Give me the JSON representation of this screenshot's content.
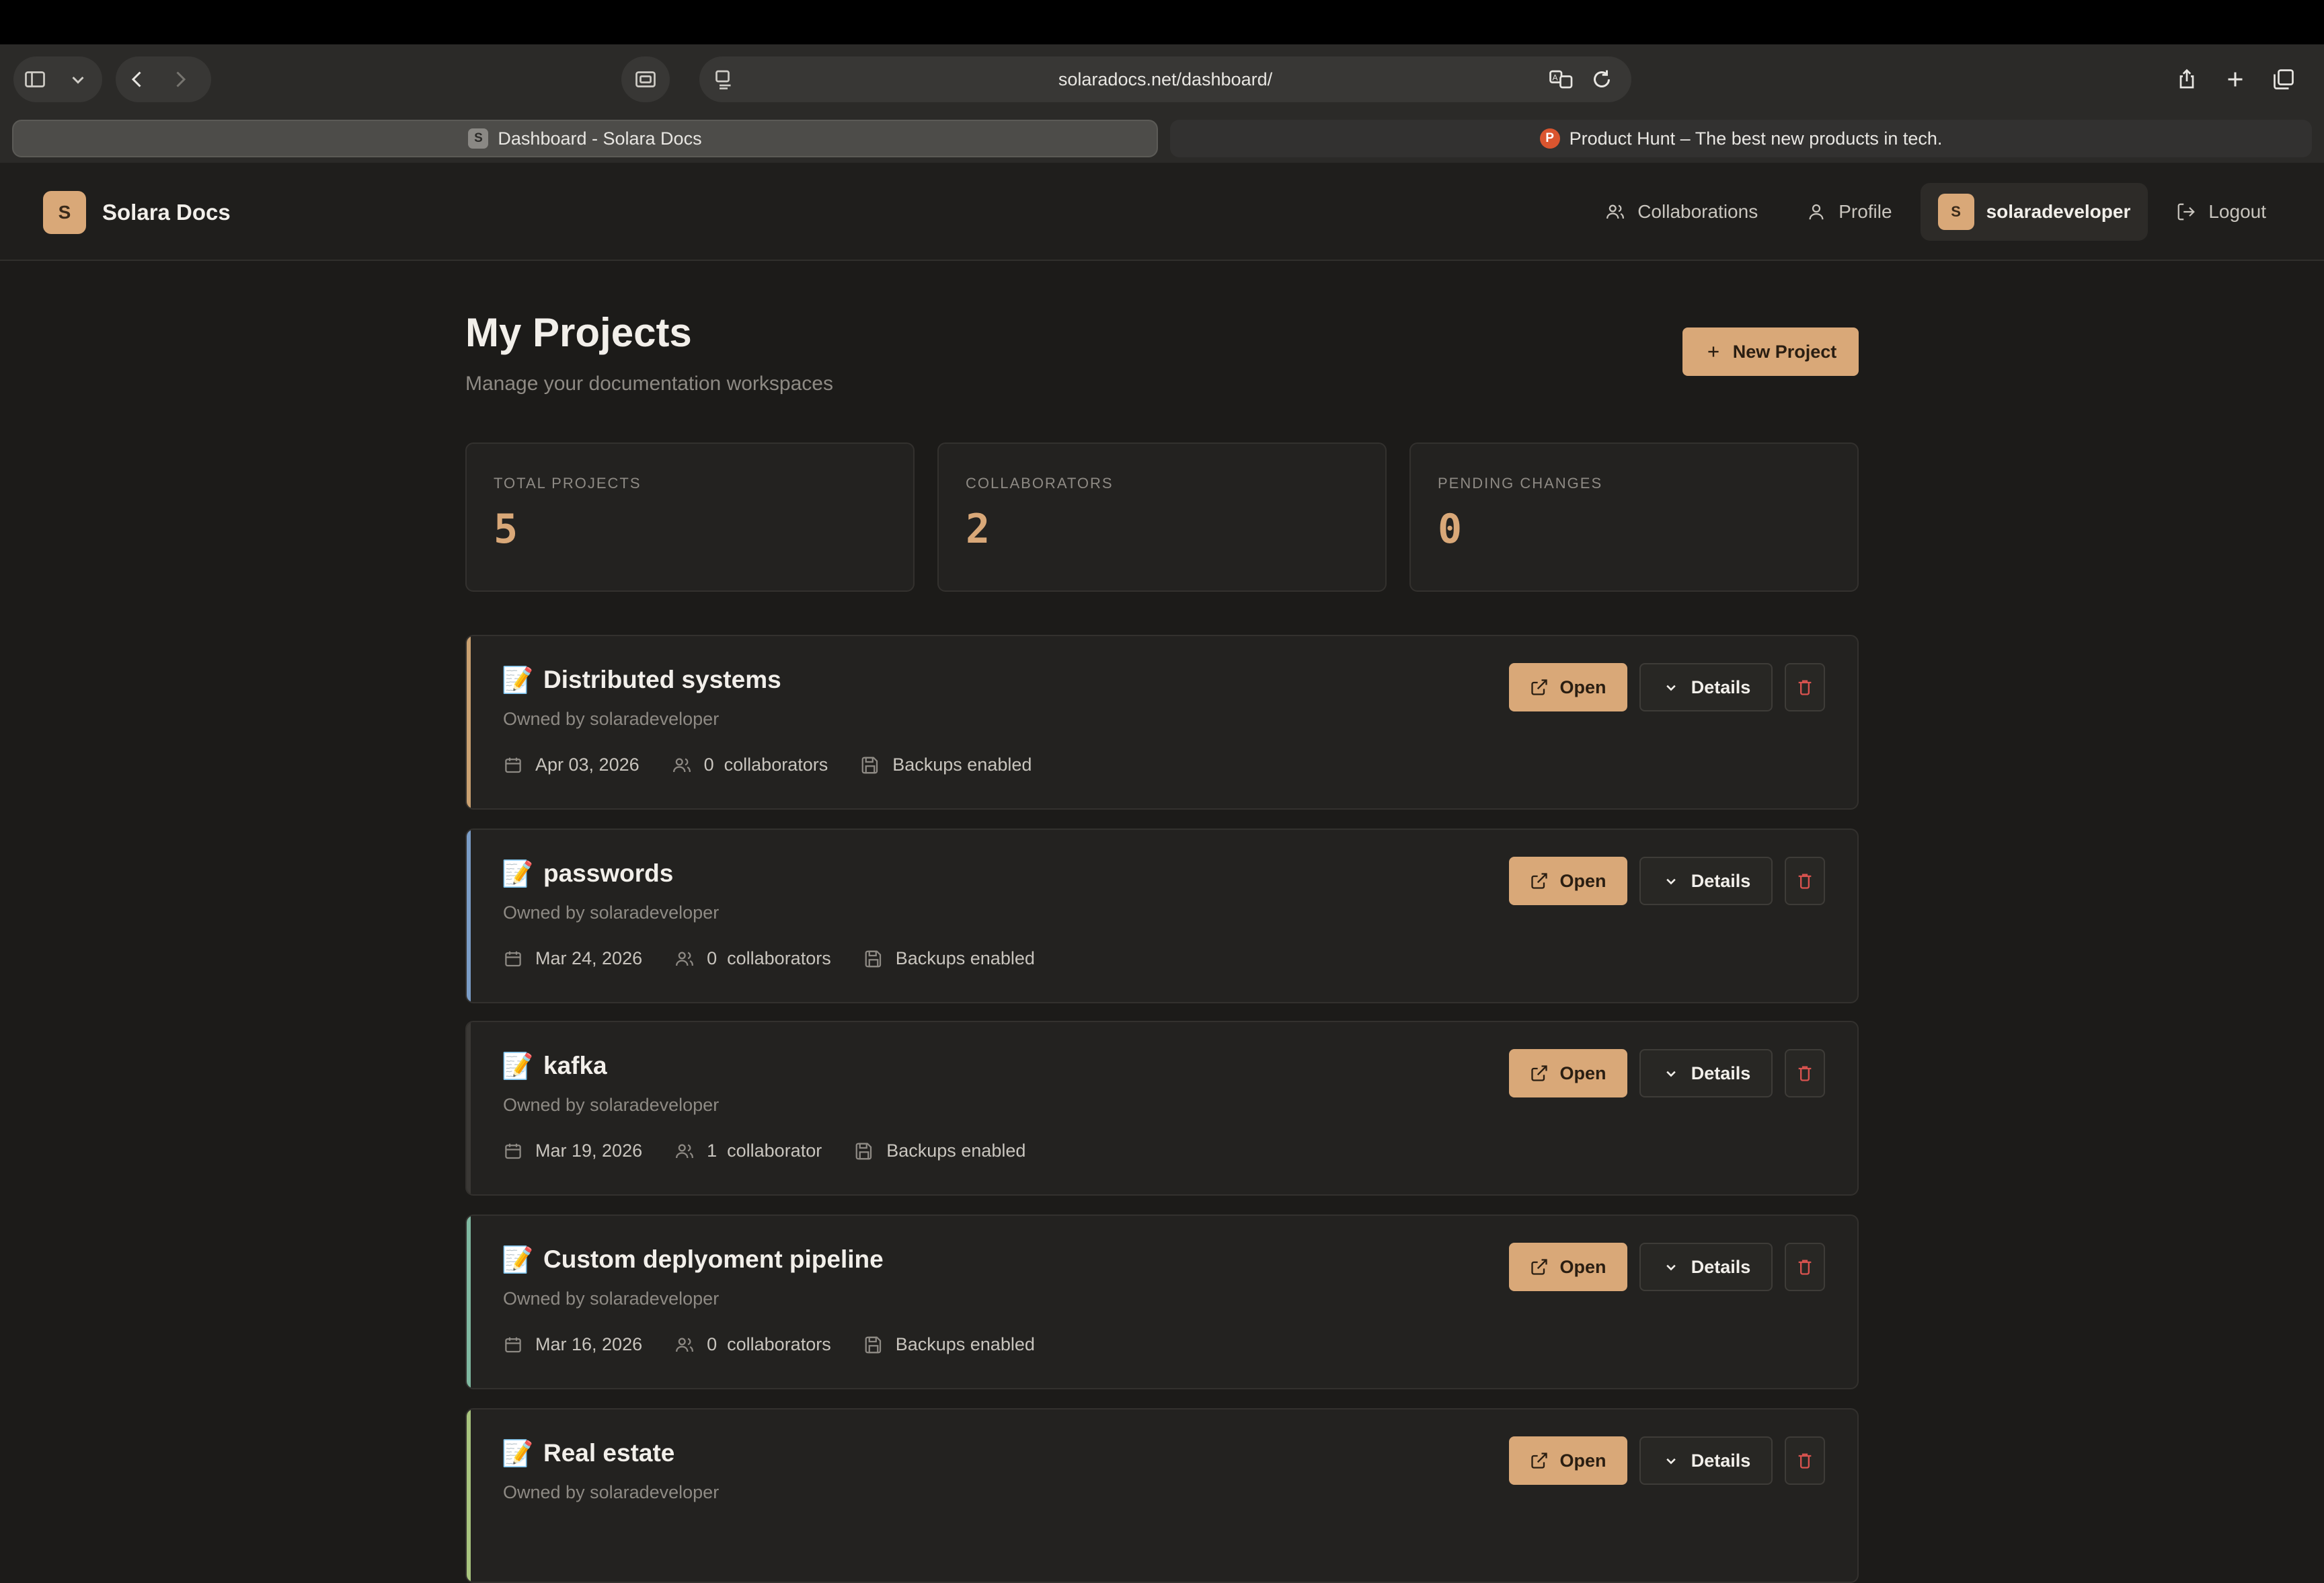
{
  "browser": {
    "url": "solaradocs.net/dashboard/",
    "tabs": [
      {
        "title": "Dashboard - Solara Docs",
        "favicon": "S"
      },
      {
        "title": "Product Hunt – The best new products in tech.",
        "favicon": "P"
      }
    ]
  },
  "header": {
    "logo_letter": "S",
    "brand": "Solara Docs",
    "nav": {
      "collaborations": "Collaborations",
      "profile": "Profile",
      "avatar_letter": "S",
      "username": "solaradeveloper",
      "logout": "Logout"
    }
  },
  "main": {
    "title": "My Projects",
    "subtitle": "Manage your documentation workspaces",
    "new_project": "New Project"
  },
  "stats": [
    {
      "label": "TOTAL PROJECTS",
      "value": "5"
    },
    {
      "label": "COLLABORATORS",
      "value": "2"
    },
    {
      "label": "PENDING CHANGES",
      "value": "0"
    }
  ],
  "actions": {
    "open": "Open",
    "details": "Details"
  },
  "projects": [
    {
      "icon": "📝",
      "name": "Distributed systems",
      "owner": "Owned by solaradeveloper",
      "date": "Apr 03, 2026",
      "collaborators": "0  collaborators",
      "backups": "Backups enabled",
      "accent": "#c9a070"
    },
    {
      "icon": "📝",
      "name": "passwords",
      "owner": "Owned by solaradeveloper",
      "date": "Mar 24, 2026",
      "collaborators": "0  collaborators",
      "backups": "Backups enabled",
      "accent": "#7a9cc6"
    },
    {
      "icon": "📝",
      "name": "kafka",
      "owner": "Owned by solaradeveloper",
      "date": "Mar 19, 2026",
      "collaborators": "1  collaborator",
      "backups": "Backups enabled",
      "accent": "#3a3835"
    },
    {
      "icon": "📝",
      "name": "Custom deplyoment pipeline",
      "owner": "Owned by solaradeveloper",
      "date": "Mar 16, 2026",
      "collaborators": "0  collaborators",
      "backups": "Backups enabled",
      "accent": "#7fb8a0"
    },
    {
      "icon": "📝",
      "name": "Real estate",
      "owner": "Owned by solaradeveloper",
      "date": "",
      "collaborators": "",
      "backups": "",
      "accent": "#a8c47e"
    }
  ]
}
